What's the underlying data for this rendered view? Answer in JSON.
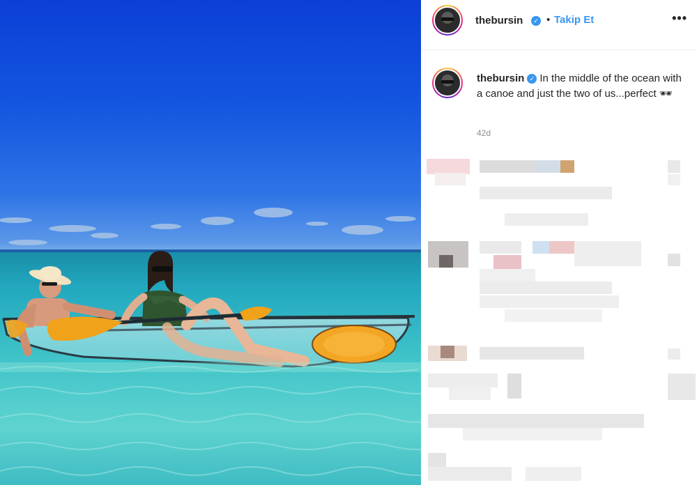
{
  "post": {
    "username": "thebursin",
    "verified_mark": "✓",
    "separator": "•",
    "follow_label": "Takip Et",
    "more_label": "•••",
    "caption_text": "In the middle of the ocean with a canoe and just the two of us...perfect",
    "caption_emoji": "🕶",
    "age": "42d"
  },
  "icons": {
    "verified": "verified-badge-icon",
    "more": "more-options-icon"
  },
  "colors": {
    "link_blue": "#3897f0",
    "text": "#262626",
    "muted": "#8e8e8e"
  }
}
